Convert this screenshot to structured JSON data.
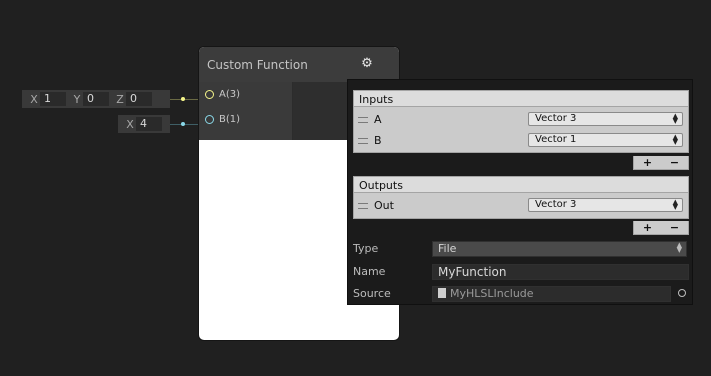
{
  "inline_inputs": [
    {
      "fields": [
        {
          "label": "X",
          "value": "1"
        },
        {
          "label": "Y",
          "value": "0"
        },
        {
          "label": "Z",
          "value": "0"
        }
      ]
    },
    {
      "fields": [
        {
          "label": "X",
          "value": "4"
        }
      ]
    }
  ],
  "node": {
    "title": "Custom Function",
    "ports_in": [
      {
        "label": "A(3)",
        "color": "#f5f58a"
      },
      {
        "label": "B(1)",
        "color": "#8ad8e8"
      }
    ]
  },
  "panel": {
    "inputs_title": "Inputs",
    "inputs": [
      {
        "name": "A",
        "type": "Vector 3"
      },
      {
        "name": "B",
        "type": "Vector 1"
      }
    ],
    "outputs_title": "Outputs",
    "outputs": [
      {
        "name": "Out",
        "type": "Vector 3"
      }
    ],
    "add_label": "+",
    "remove_label": "−",
    "type_label": "Type",
    "type_value": "File",
    "name_label": "Name",
    "name_value": "MyFunction",
    "source_label": "Source",
    "source_value": "MyHLSLInclude"
  },
  "colors": {
    "background": "#202020",
    "vector3_port": "#f5f58a",
    "vector1_port": "#8ad8e8",
    "node_body": "#ffffff"
  },
  "icons": [
    "gear-icon",
    "drag-handle-icon",
    "dropdown-arrow-icon",
    "file-icon",
    "object-picker-icon"
  ]
}
